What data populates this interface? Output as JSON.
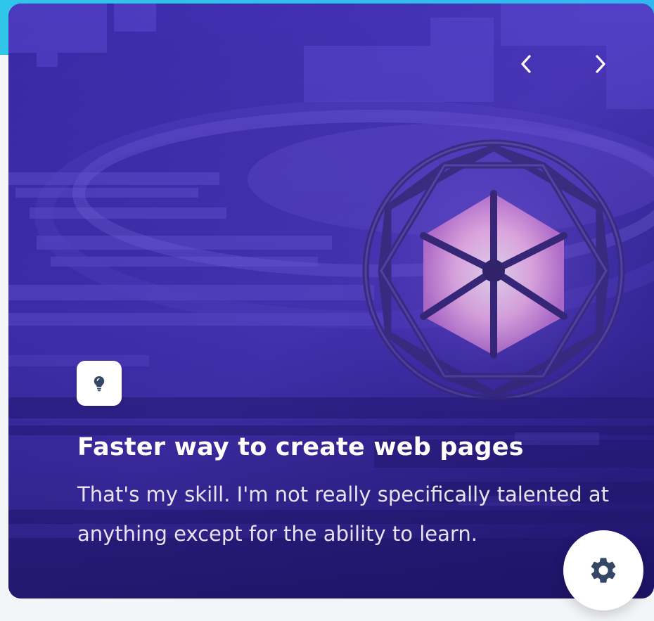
{
  "card": {
    "title": "Faster way to create web pages",
    "description": "That's my skill. I'm not really specifically talented at anything except for the ability to learn.",
    "badge_icon": "lightbulb-icon"
  },
  "navigation": {
    "prev_icon": "chevron-left-icon",
    "next_icon": "chevron-right-icon"
  },
  "settings": {
    "icon": "gear-icon"
  },
  "colors": {
    "accent_strip": "#30c0ec",
    "card_base": "#3f2da8",
    "sphere_glow": "#f6c8f2",
    "icon_dark": "#344767"
  }
}
